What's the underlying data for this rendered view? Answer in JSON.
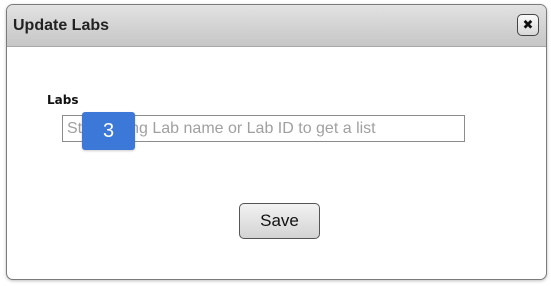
{
  "dialog": {
    "title": "Update Labs",
    "close_icon": "close-icon",
    "close_glyph": "✖"
  },
  "form": {
    "labs_label": "Labs",
    "labs_input": {
      "value": "",
      "placeholder": "Start typing Lab name or Lab ID to get a list"
    },
    "save_label": "Save"
  },
  "overlay_badge": {
    "text": "3",
    "color": "#3c78d8"
  }
}
